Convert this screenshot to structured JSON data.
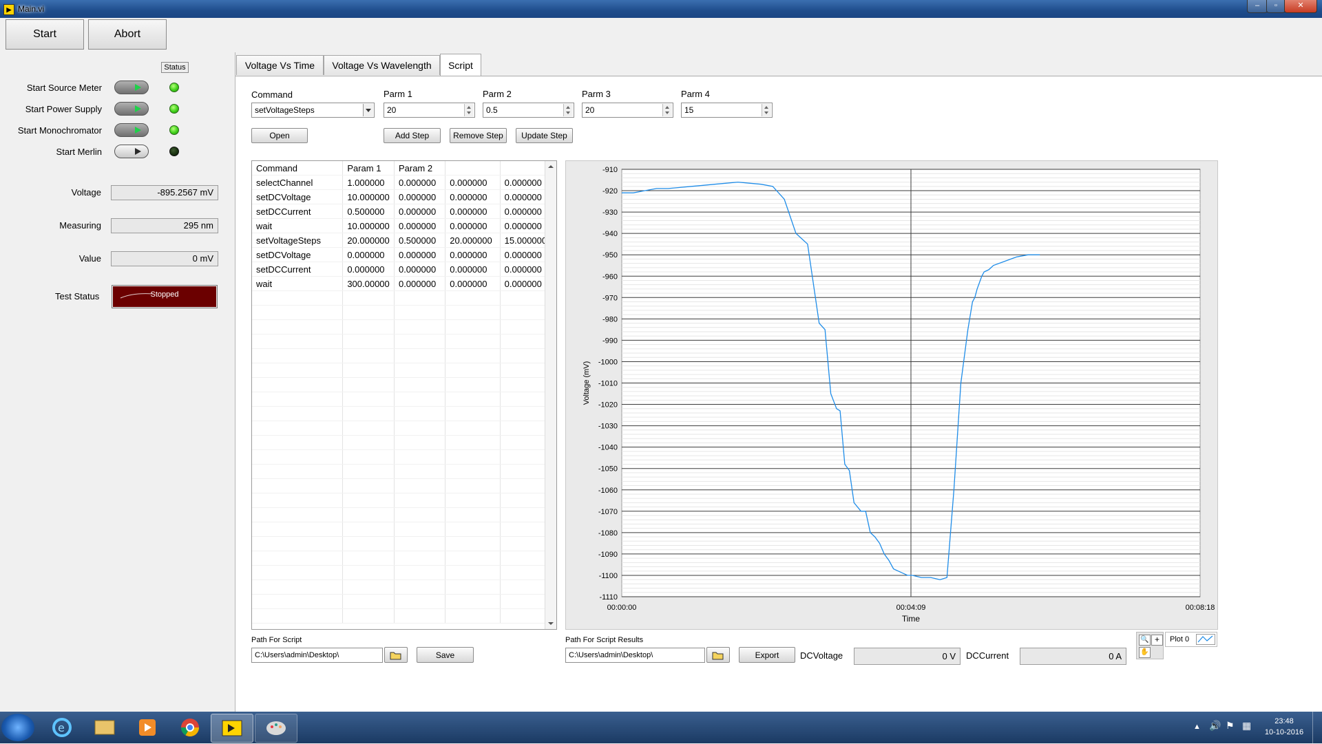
{
  "window": {
    "title": "Main.vi",
    "icon": "labview-vi-icon"
  },
  "toolbar": {
    "start_label": "Start",
    "abort_label": "Abort"
  },
  "status_panel": {
    "status_header": "Status",
    "items": [
      {
        "label": "Start Source Meter",
        "on": true
      },
      {
        "label": "Start Power Supply",
        "on": true
      },
      {
        "label": "Start Monochromator",
        "on": true
      },
      {
        "label": "Start Merlin",
        "on": false
      }
    ],
    "readouts": [
      {
        "label": "Voltage",
        "value": "-895.2567 mV"
      },
      {
        "label": "Measuring",
        "value": "295 nm"
      },
      {
        "label": "Value",
        "value": "0 mV"
      }
    ],
    "test_status_label": "Test Status",
    "test_status_value": "Stopped",
    "test_status_color": "#6b0000"
  },
  "tabs": [
    {
      "label": "Voltage Vs Time",
      "active": false
    },
    {
      "label": "Voltage Vs Wavelength",
      "active": false
    },
    {
      "label": "Script",
      "active": true
    }
  ],
  "script": {
    "command_label": "Command",
    "command_value": "setVoltageSteps",
    "parms": [
      {
        "label": "Parm 1",
        "value": "20"
      },
      {
        "label": "Parm 2",
        "value": "0.5"
      },
      {
        "label": "Parm 3",
        "value": "20"
      },
      {
        "label": "Parm 4",
        "value": "15"
      }
    ],
    "open_label": "Open",
    "add_step_label": "Add Step",
    "remove_step_label": "Remove Step",
    "update_step_label": "Update Step",
    "table": {
      "headers": [
        "Command",
        "Param 1",
        "Param 2",
        "",
        ""
      ],
      "rows": [
        [
          "selectChannel",
          "1.000000",
          "0.000000",
          "0.000000",
          "0.000000"
        ],
        [
          "setDCVoltage",
          "10.000000",
          "0.000000",
          "0.000000",
          "0.000000"
        ],
        [
          "setDCCurrent",
          "0.500000",
          "0.000000",
          "0.000000",
          "0.000000"
        ],
        [
          "wait",
          "10.000000",
          "0.000000",
          "0.000000",
          "0.000000"
        ],
        [
          "setVoltageSteps",
          "20.000000",
          "0.500000",
          "20.000000",
          "15.000000"
        ],
        [
          "setDCVoltage",
          "0.000000",
          "0.000000",
          "0.000000",
          "0.000000"
        ],
        [
          "setDCCurrent",
          "0.000000",
          "0.000000",
          "0.000000",
          "0.000000"
        ],
        [
          "wait",
          "300.00000",
          "0.000000",
          "0.000000",
          "0.000000"
        ]
      ]
    },
    "path_label": "Path For Script",
    "path_value": "C:\\Users\\admin\\Desktop\\",
    "save_label": "Save",
    "results_path_label": "Path For Script Results",
    "results_path_value": "C:\\Users\\admin\\Desktop\\",
    "export_label": "Export",
    "dcvoltage_label": "DCVoltage",
    "dcvoltage_value": "0 V",
    "dccurrent_label": "DCCurrent",
    "dccurrent_value": "0 A",
    "plot_legend_label": "Plot 0"
  },
  "chart_data": {
    "type": "line",
    "xlabel": "Time",
    "ylabel": "Voltage (mV)",
    "ylim": [
      -1110,
      -910
    ],
    "yticks": [
      -910,
      -920,
      -930,
      -940,
      -950,
      -960,
      -970,
      -980,
      -990,
      -1000,
      -1010,
      -1020,
      -1030,
      -1040,
      -1050,
      -1060,
      -1070,
      -1080,
      -1090,
      -1100,
      -1110
    ],
    "xlim_seconds": [
      0,
      498
    ],
    "xtick_labels": [
      "00:00:00",
      "00:04:09",
      "00:08:18"
    ],
    "grid": true,
    "line_color": "#1e8ce8",
    "series": [
      {
        "x_seconds": [
          0,
          10,
          20,
          30,
          40,
          50,
          60,
          70,
          80,
          90,
          100,
          110,
          120,
          130,
          140,
          150,
          160,
          170,
          175,
          180,
          185,
          188,
          192,
          196,
          200,
          206,
          210,
          214,
          218,
          222,
          226,
          230,
          234,
          238,
          242,
          246,
          250,
          254,
          258,
          262,
          266,
          270,
          274,
          280,
          286,
          292,
          298,
          302,
          304,
          306,
          308,
          310,
          312,
          316,
          320,
          330,
          340,
          350,
          360,
          370,
          376
        ],
        "y": [
          -921,
          -921,
          -920,
          -919,
          -919,
          -918.5,
          -918,
          -917.5,
          -917,
          -916.5,
          -916,
          -916.5,
          -917,
          -918,
          -924,
          -940,
          -945,
          -982,
          -985,
          -1015,
          -1022,
          -1023,
          -1048,
          -1051,
          -1066,
          -1070,
          -1070,
          -1080,
          -1082,
          -1085,
          -1090,
          -1093,
          -1097,
          -1098,
          -1099,
          -1100,
          -1100,
          -1100.5,
          -1101,
          -1101,
          -1101,
          -1101.5,
          -1102,
          -1101,
          -1060,
          -1010,
          -985,
          -972,
          -970,
          -966,
          -963,
          -960,
          -958,
          -957,
          -955,
          -953,
          -951,
          -950,
          -950
        ]
      }
    ]
  }
}
